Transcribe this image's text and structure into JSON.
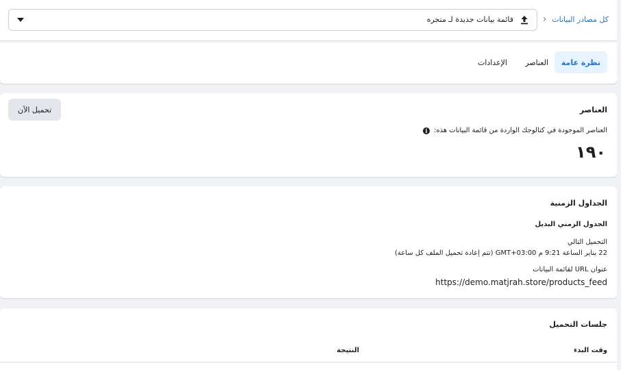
{
  "breadcrumb": {
    "all_sources": "كل مصادر البيانات",
    "chevron": "‹"
  },
  "feed_select": {
    "selected": "قائمة بيانات جديدة لـ متجره",
    "icon": "upload-icon"
  },
  "tabs": [
    {
      "label": "نظرة عامة",
      "active": true
    },
    {
      "label": "العناصر",
      "active": false
    },
    {
      "label": "الإعدادات",
      "active": false
    }
  ],
  "items_card": {
    "title": "العناصر",
    "upload_now": "تحميل الآن",
    "description": "العناصر الموجودة في كتالوجك الواردة من قائمة البيانات هذه:",
    "info_icon": "info-icon",
    "count": "١٩٠"
  },
  "schedule_card": {
    "title": "الجداول الزمنية",
    "alt_schedule": "الجدول الزمني البديل",
    "next_upload_label": "التحميل التالي",
    "next_upload_value": "22 يناير الساعة 9:21 م GMT+03:00 (تتم إعادة تحميل الملف كل ساعة)",
    "url_label": "عنوان URL لقائمة البيانات",
    "url_value": "https://demo.matjrah.store/products_feed"
  },
  "sessions_card": {
    "title": "جلسات التحميل",
    "col_start": "وقت البدء",
    "col_result": "النتيجة"
  },
  "colors": {
    "accent": "#1b74e4",
    "active_tab_bg": "#e7f3ff",
    "page_bg": "#f0f2f5",
    "button_bg": "#e4e6eb"
  }
}
